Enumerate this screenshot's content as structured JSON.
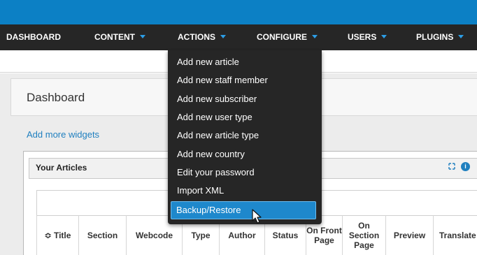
{
  "nav": {
    "items": [
      {
        "label": "DASHBOARD",
        "has_caret": false
      },
      {
        "label": "CONTENT",
        "has_caret": true
      },
      {
        "label": "ACTIONS",
        "has_caret": true
      },
      {
        "label": "CONFIGURE",
        "has_caret": true
      },
      {
        "label": "USERS",
        "has_caret": true
      },
      {
        "label": "PLUGINS",
        "has_caret": true
      }
    ]
  },
  "page": {
    "title": "Dashboard",
    "add_widgets_link": "Add more widgets"
  },
  "widget": {
    "title": "Your Articles",
    "icons": [
      "expand-icon",
      "info-icon"
    ],
    "info_glyph": "i"
  },
  "table": {
    "columns": [
      {
        "label": "≎ Title"
      },
      {
        "label": "Section"
      },
      {
        "label": "Webcode"
      },
      {
        "label": "Type"
      },
      {
        "label": "Author"
      },
      {
        "label": "Status"
      },
      {
        "label": "On Front Page"
      },
      {
        "label": "On Section Page"
      },
      {
        "label": "Preview"
      },
      {
        "label": "Translate"
      }
    ]
  },
  "actions_menu": {
    "items": [
      "Add new article",
      "Add new staff member",
      "Add new subscriber",
      "Add new user type",
      "Add new article type",
      "Add new country",
      "Edit your password",
      "Import XML"
    ],
    "selected_item": "Backup/Restore"
  },
  "colors": {
    "topbar": "#0c80c5",
    "navbar": "#262626",
    "caret": "#2c9ee6",
    "menu_highlight": "#1e88cc",
    "link": "#1f7fbf"
  }
}
